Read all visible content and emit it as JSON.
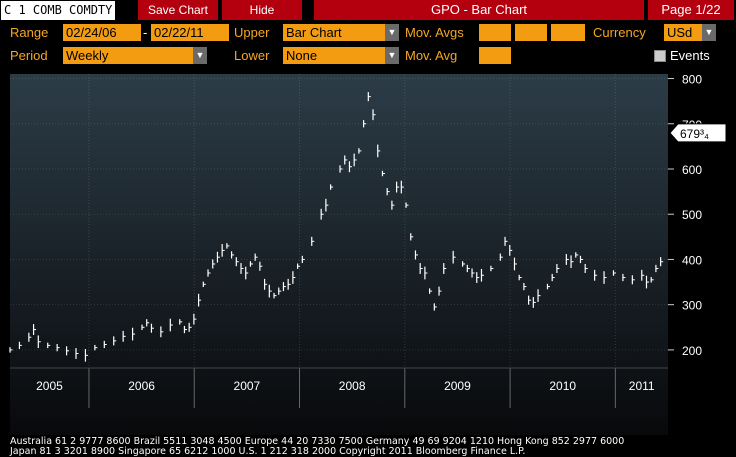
{
  "header": {
    "ticker": "C 1 COMB COMDTY",
    "save_chart": "Save Chart",
    "hide": "Hide",
    "title": "GPO - Bar Chart",
    "page": "Page 1/22"
  },
  "controls": {
    "range_label": "Range",
    "range_start": "02/24/06",
    "range_dash": "-",
    "range_end": "02/22/11",
    "upper_label": "Upper",
    "upper_value": "Bar Chart",
    "movavgs_label": "Mov. Avgs",
    "currency_label": "Currency",
    "currency_value": "USd",
    "period_label": "Period",
    "period_value": "Weekly",
    "lower_label": "Lower",
    "lower_value": "None",
    "movavg_label": "Mov. Avg",
    "events_label": "Events",
    "colors": {
      "label": "#f5a623",
      "field": "#f39c12",
      "button": "#b4000e"
    }
  },
  "chart_data": {
    "type": "bar",
    "x_ticks": [
      "2005",
      "2006",
      "2007",
      "2008",
      "2009",
      "2010",
      "2011"
    ],
    "y_ticks": [
      "200",
      "300",
      "400",
      "500",
      "600",
      "700",
      "800"
    ],
    "ylim": [
      160,
      810
    ],
    "xlim": [
      2005.0,
      2011.25
    ],
    "last_price_label": "679³₄",
    "last_price": 679.75,
    "grid": true,
    "series": [
      {
        "points": [
          [
            2005.0,
            200
          ],
          [
            2005.1,
            210
          ],
          [
            2005.2,
            228
          ],
          [
            2005.25,
            245
          ],
          [
            2005.3,
            218
          ],
          [
            2005.4,
            210
          ],
          [
            2005.5,
            205
          ],
          [
            2005.6,
            198
          ],
          [
            2005.7,
            192
          ],
          [
            2005.8,
            188
          ],
          [
            2005.9,
            205
          ],
          [
            2006.0,
            212
          ],
          [
            2006.1,
            220
          ],
          [
            2006.2,
            230
          ],
          [
            2006.3,
            235
          ],
          [
            2006.4,
            250
          ],
          [
            2006.45,
            260
          ],
          [
            2006.5,
            248
          ],
          [
            2006.6,
            240
          ],
          [
            2006.7,
            255
          ],
          [
            2006.8,
            262
          ],
          [
            2006.85,
            245
          ],
          [
            2006.9,
            250
          ],
          [
            2006.95,
            268
          ],
          [
            2007.0,
            310
          ],
          [
            2007.05,
            345
          ],
          [
            2007.1,
            370
          ],
          [
            2007.15,
            390
          ],
          [
            2007.2,
            405
          ],
          [
            2007.25,
            420
          ],
          [
            2007.3,
            430
          ],
          [
            2007.35,
            410
          ],
          [
            2007.4,
            395
          ],
          [
            2007.45,
            380
          ],
          [
            2007.5,
            370
          ],
          [
            2007.55,
            390
          ],
          [
            2007.6,
            405
          ],
          [
            2007.65,
            385
          ],
          [
            2007.7,
            345
          ],
          [
            2007.75,
            330
          ],
          [
            2007.8,
            320
          ],
          [
            2007.85,
            330
          ],
          [
            2007.9,
            340
          ],
          [
            2007.95,
            345
          ],
          [
            2008.0,
            360
          ],
          [
            2008.05,
            385
          ],
          [
            2008.1,
            400
          ],
          [
            2008.2,
            440
          ],
          [
            2008.3,
            500
          ],
          [
            2008.35,
            520
          ],
          [
            2008.4,
            560
          ],
          [
            2008.5,
            600
          ],
          [
            2008.55,
            620
          ],
          [
            2008.6,
            605
          ],
          [
            2008.65,
            620
          ],
          [
            2008.7,
            640
          ],
          [
            2008.75,
            700
          ],
          [
            2008.8,
            760
          ],
          [
            2008.85,
            720
          ],
          [
            2008.9,
            640
          ],
          [
            2008.95,
            590
          ],
          [
            2009.0,
            550
          ],
          [
            2009.05,
            520
          ],
          [
            2009.1,
            560
          ],
          [
            2009.15,
            560
          ],
          [
            2009.2,
            520
          ],
          [
            2009.25,
            450
          ],
          [
            2009.3,
            410
          ],
          [
            2009.35,
            380
          ],
          [
            2009.4,
            370
          ],
          [
            2009.45,
            330
          ],
          [
            2009.5,
            295
          ],
          [
            2009.55,
            330
          ],
          [
            2009.6,
            380
          ],
          [
            2009.7,
            405
          ],
          [
            2009.8,
            390
          ],
          [
            2009.85,
            380
          ],
          [
            2009.9,
            370
          ],
          [
            2009.95,
            360
          ],
          [
            2010.0,
            365
          ],
          [
            2010.1,
            380
          ],
          [
            2010.2,
            405
          ],
          [
            2010.25,
            440
          ],
          [
            2010.3,
            420
          ],
          [
            2010.35,
            390
          ],
          [
            2010.4,
            360
          ],
          [
            2010.45,
            340
          ],
          [
            2010.5,
            310
          ],
          [
            2010.55,
            305
          ],
          [
            2010.6,
            320
          ],
          [
            2010.7,
            340
          ],
          [
            2010.75,
            360
          ],
          [
            2010.8,
            380
          ],
          [
            2010.9,
            400
          ],
          [
            2010.95,
            395
          ],
          [
            2011.0,
            410
          ],
          [
            2011.05,
            400
          ],
          [
            2011.1,
            380
          ],
          [
            2011.2,
            365
          ],
          [
            2011.3,
            360
          ],
          [
            2011.4,
            370
          ],
          [
            2011.5,
            360
          ],
          [
            2011.6,
            355
          ],
          [
            2011.7,
            365
          ],
          [
            2011.75,
            350
          ],
          [
            2011.8,
            355
          ],
          [
            2011.85,
            380
          ],
          [
            2011.9,
            395
          ]
        ]
      }
    ]
  },
  "footer": {
    "line1": "Australia 61 2 9777 8600 Brazil 5511 3048 4500 Europe 44 20 7330 7500 Germany 49 69 9204 1210 Hong Kong 852 2977 6000",
    "line2": "Japan 81 3 3201 8900          Singapore 65 6212 1000          U.S. 1 212 318 2000          Copyright 2011 Bloomberg Finance L.P."
  }
}
